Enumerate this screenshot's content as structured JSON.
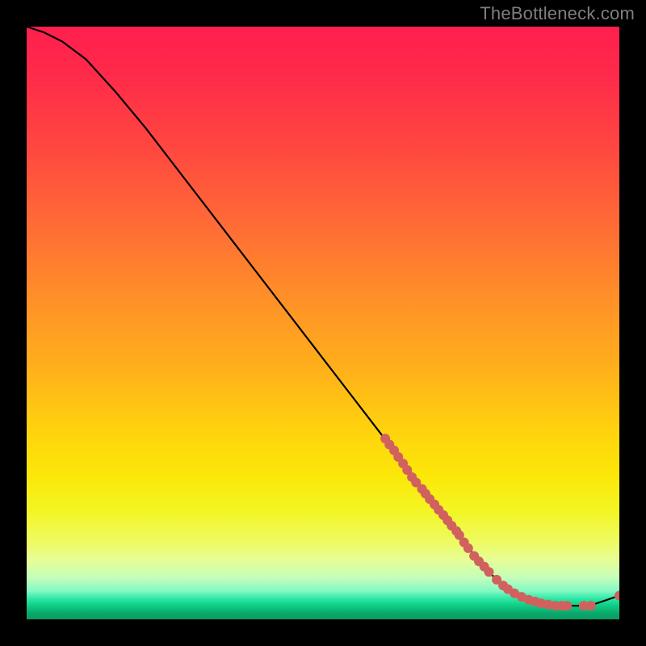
{
  "watermark": "TheBottleneck.com",
  "chart_data": {
    "type": "line",
    "title": "",
    "xlabel": "",
    "ylabel": "",
    "xlim": [
      0,
      100
    ],
    "ylim": [
      0,
      100
    ],
    "grid": false,
    "legend": false,
    "series": [
      {
        "name": "curve",
        "color": "#000000",
        "x": [
          0,
          3,
          6,
          10,
          15,
          20,
          25,
          30,
          35,
          40,
          45,
          50,
          55,
          60,
          65,
          70,
          73,
          75,
          77,
          80,
          85,
          90,
          95,
          100
        ],
        "y": [
          100,
          99,
          97.5,
          94.5,
          89,
          83,
          76.5,
          70,
          63.5,
          57,
          50.5,
          44,
          37.5,
          31,
          24.5,
          18,
          14,
          11.5,
          9,
          6,
          3.3,
          2.3,
          2.3,
          4
        ]
      }
    ],
    "scatter": {
      "name": "points",
      "color": "#d1615e",
      "radius_px": 6,
      "points": [
        {
          "x": 60.5,
          "y": 30.5
        },
        {
          "x": 61.2,
          "y": 29.5
        },
        {
          "x": 62.0,
          "y": 28.5
        },
        {
          "x": 62.7,
          "y": 27.4
        },
        {
          "x": 63.5,
          "y": 26.3
        },
        {
          "x": 64.2,
          "y": 25.2
        },
        {
          "x": 65.0,
          "y": 24.0
        },
        {
          "x": 65.7,
          "y": 23.1
        },
        {
          "x": 66.7,
          "y": 22.0
        },
        {
          "x": 67.3,
          "y": 21.2
        },
        {
          "x": 68.0,
          "y": 20.3
        },
        {
          "x": 68.8,
          "y": 19.4
        },
        {
          "x": 69.5,
          "y": 18.5
        },
        {
          "x": 70.3,
          "y": 17.6
        },
        {
          "x": 71.0,
          "y": 16.7
        },
        {
          "x": 71.7,
          "y": 15.8
        },
        {
          "x": 72.5,
          "y": 14.9
        },
        {
          "x": 73.0,
          "y": 14.2
        },
        {
          "x": 73.8,
          "y": 13.0
        },
        {
          "x": 74.5,
          "y": 12.0
        },
        {
          "x": 75.5,
          "y": 10.7
        },
        {
          "x": 76.3,
          "y": 9.8
        },
        {
          "x": 77.2,
          "y": 8.9
        },
        {
          "x": 78.0,
          "y": 8.0
        },
        {
          "x": 79.3,
          "y": 6.7
        },
        {
          "x": 80.4,
          "y": 5.7
        },
        {
          "x": 81.2,
          "y": 5.1
        },
        {
          "x": 82.3,
          "y": 4.4
        },
        {
          "x": 83.5,
          "y": 3.8
        },
        {
          "x": 84.7,
          "y": 3.3
        },
        {
          "x": 85.8,
          "y": 3.0
        },
        {
          "x": 86.8,
          "y": 2.7
        },
        {
          "x": 88.0,
          "y": 2.5
        },
        {
          "x": 89.2,
          "y": 2.3
        },
        {
          "x": 90.3,
          "y": 2.3
        },
        {
          "x": 91.2,
          "y": 2.3
        },
        {
          "x": 94.0,
          "y": 2.3
        },
        {
          "x": 95.2,
          "y": 2.3
        },
        {
          "x": 100.0,
          "y": 4.0
        }
      ]
    },
    "gradient_stops": [
      {
        "pos": 0.0,
        "color": "#ff1f4e"
      },
      {
        "pos": 0.33,
        "color": "#ff6a36"
      },
      {
        "pos": 0.68,
        "color": "#ffd20e"
      },
      {
        "pos": 0.87,
        "color": "#edfb63"
      },
      {
        "pos": 0.955,
        "color": "#49eead"
      },
      {
        "pos": 1.0,
        "color": "#0a9a61"
      }
    ]
  }
}
